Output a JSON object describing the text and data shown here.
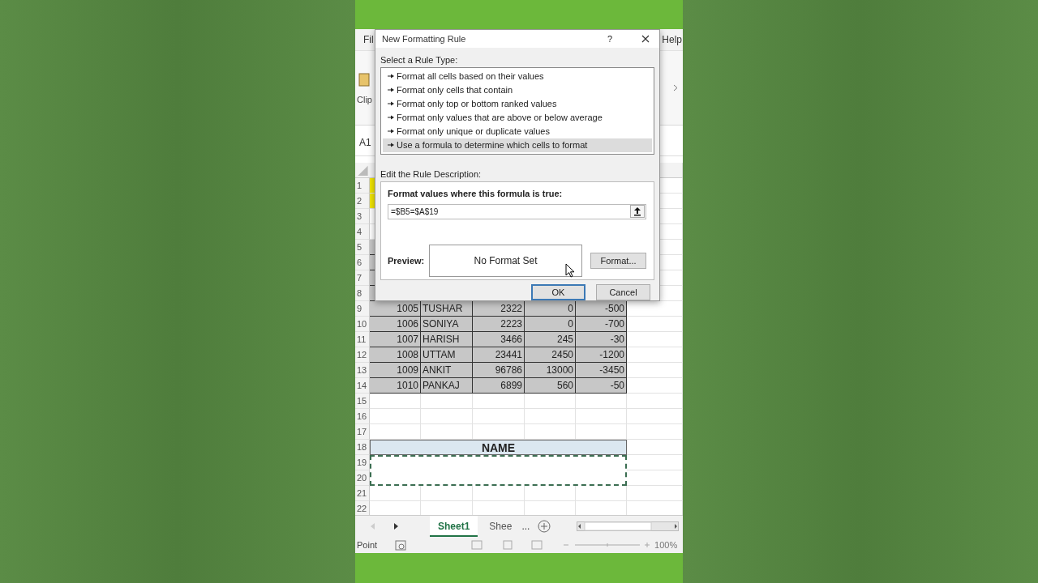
{
  "excel": {
    "menu": {
      "left": "Fil",
      "right": "Help"
    },
    "ribbon": {
      "group_label": "Clip"
    },
    "name_box": "A1",
    "sheet": {
      "rows": [
        {
          "number": "1",
          "kind": "highlight"
        },
        {
          "number": "2",
          "kind": "highlight"
        },
        {
          "number": "3",
          "kind": "blank"
        },
        {
          "number": "4",
          "kind": "blank"
        },
        {
          "number": "5",
          "kind": "data",
          "cells": []
        },
        {
          "number": "6",
          "kind": "data",
          "cells": []
        },
        {
          "number": "7",
          "kind": "data",
          "cells": []
        },
        {
          "number": "8",
          "kind": "data",
          "cells": []
        },
        {
          "number": "9",
          "kind": "data",
          "cells": [
            "1005",
            "TUSHAR",
            "2322",
            "0",
            "-500"
          ]
        },
        {
          "number": "10",
          "kind": "data",
          "cells": [
            "1006",
            "SONIYA",
            "2223",
            "0",
            "-700"
          ]
        },
        {
          "number": "11",
          "kind": "data",
          "cells": [
            "1007",
            "HARISH",
            "3466",
            "245",
            "-30"
          ]
        },
        {
          "number": "12",
          "kind": "data",
          "cells": [
            "1008",
            "UTTAM",
            "23441",
            "2450",
            "-1200"
          ]
        },
        {
          "number": "13",
          "kind": "data",
          "cells": [
            "1009",
            "ANKIT",
            "96786",
            "13000",
            "-3450"
          ]
        },
        {
          "number": "14",
          "kind": "data",
          "cells": [
            "1010",
            "PANKAJ",
            "6899",
            "560",
            "-50"
          ]
        },
        {
          "number": "15",
          "kind": "blank"
        },
        {
          "number": "16",
          "kind": "blank"
        },
        {
          "number": "17",
          "kind": "blank"
        },
        {
          "number": "18",
          "kind": "title",
          "cells": [
            "NAME"
          ]
        },
        {
          "number": "19",
          "kind": "marquee"
        },
        {
          "number": "20",
          "kind": "continued"
        },
        {
          "number": "21",
          "kind": "blank"
        },
        {
          "number": "22",
          "kind": "blank"
        }
      ]
    },
    "sheet_tabs": [
      {
        "label": "Sheet1",
        "selected": true
      },
      {
        "label": "Shee",
        "selected": false
      }
    ],
    "more_tabs": "...",
    "status_bar": {
      "mode": "Point",
      "zoom": "100%"
    }
  },
  "dialog": {
    "title": "New Formatting Rule",
    "help": "?",
    "rule_type_label": "Select a Rule Type:",
    "rule_types": [
      {
        "label": "Format all cells based on their values",
        "selected": false
      },
      {
        "label": "Format only cells that contain",
        "selected": false
      },
      {
        "label": "Format only top or bottom ranked values",
        "selected": false
      },
      {
        "label": "Format only values that are above or below average",
        "selected": false
      },
      {
        "label": "Format only unique or duplicate values",
        "selected": false
      },
      {
        "label": "Use a formula to determine which cells to format",
        "selected": true
      }
    ],
    "description_label": "Edit the Rule Description:",
    "formula_label": "Format values where this formula is true:",
    "formula": "=$B5=$A$19",
    "preview_label": "Preview:",
    "preview_text": "No Format Set",
    "buttons": {
      "format": "Format...",
      "ok": "OK",
      "cancel": "Cancel"
    }
  }
}
